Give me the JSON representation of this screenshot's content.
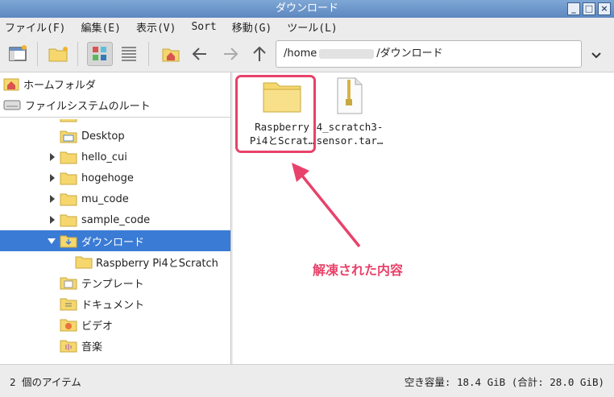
{
  "window": {
    "title": "ダウンロード"
  },
  "menu": [
    "ファイル(F)",
    "編集(E)",
    "表示(V)",
    "Sort",
    "移動(G)",
    "ツール(L)"
  ],
  "path": {
    "prefix": "/home",
    "suffix": "/ダウンロード"
  },
  "places": [
    "ホームフォルダ",
    "ファイルシステムのルート"
  ],
  "tree": [
    {
      "label": "Desktop",
      "expander": false
    },
    {
      "label": "hello_cui",
      "expander": true
    },
    {
      "label": "hogehoge",
      "expander": true
    },
    {
      "label": "mu_code",
      "expander": true
    },
    {
      "label": "sample_code",
      "expander": true
    },
    {
      "label": "ダウンロード",
      "expander": "open",
      "selected": true
    },
    {
      "label": "Raspberry Pi4とScratch",
      "expander": false
    },
    {
      "label": "テンプレート",
      "expander": false
    },
    {
      "label": "ドキュメント",
      "expander": false
    },
    {
      "label": "ビデオ",
      "expander": false
    },
    {
      "label": "音楽",
      "expander": false
    }
  ],
  "files": [
    {
      "line1": "Raspberry",
      "line2": "Pi4とScrat…"
    },
    {
      "line1": "4_scratch3-",
      "line2": "sensor.tar…"
    }
  ],
  "annotation": "解凍された内容",
  "status": {
    "count": "2 個のアイテム",
    "space": "空き容量: 18.4 GiB (合計: 28.0 GiB)"
  },
  "colors": {
    "accent": "#3a7bd5",
    "highlight": "#e8426a",
    "folder": "#f5d76e"
  }
}
